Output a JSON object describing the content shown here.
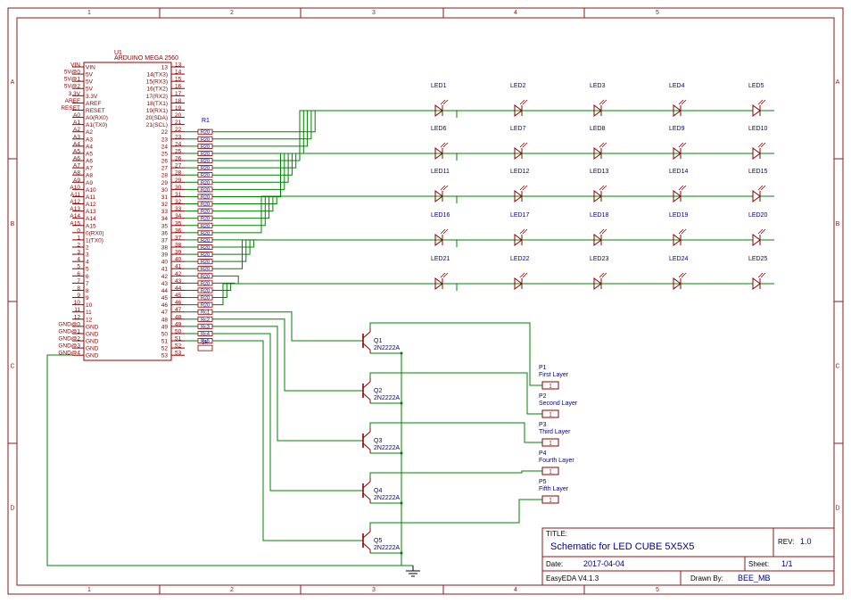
{
  "frame": {
    "col_labels": [
      "1",
      "2",
      "3",
      "4",
      "5"
    ],
    "row_labels": [
      "A",
      "B",
      "C",
      "D"
    ]
  },
  "arduino": {
    "ref": "U1",
    "name": "ARDUINO MEGA 2560",
    "left_pins": [
      {
        "num": "VIN",
        "name": "VIN"
      },
      {
        "num": "5V@0",
        "name": "5V"
      },
      {
        "num": "5V@1",
        "name": "5V"
      },
      {
        "num": "5V@2",
        "name": "5V"
      },
      {
        "num": "3.3V",
        "name": "3.3V"
      },
      {
        "num": "AREF",
        "name": "AREF"
      },
      {
        "num": "RESET",
        "name": "RESET"
      },
      {
        "num": "A0",
        "name": "A0(RX0)"
      },
      {
        "num": "A1",
        "name": "A1(TX0)"
      },
      {
        "num": "A2",
        "name": "A2"
      },
      {
        "num": "A3",
        "name": "A3"
      },
      {
        "num": "A4",
        "name": "A4"
      },
      {
        "num": "A5",
        "name": "A5"
      },
      {
        "num": "A6",
        "name": "A6"
      },
      {
        "num": "A7",
        "name": "A7"
      },
      {
        "num": "A8",
        "name": "A8"
      },
      {
        "num": "A9",
        "name": "A9"
      },
      {
        "num": "A10",
        "name": "A10"
      },
      {
        "num": "A11",
        "name": "A11"
      },
      {
        "num": "A12",
        "name": "A12"
      },
      {
        "num": "A13",
        "name": "A13"
      },
      {
        "num": "A14",
        "name": "A14"
      },
      {
        "num": "A15",
        "name": "A15"
      },
      {
        "num": "0",
        "name": "0(RX0)"
      },
      {
        "num": "1",
        "name": "1(TX0)"
      },
      {
        "num": "2",
        "name": "2"
      },
      {
        "num": "3",
        "name": "3"
      },
      {
        "num": "4",
        "name": "4"
      },
      {
        "num": "5",
        "name": "5"
      },
      {
        "num": "6",
        "name": "6"
      },
      {
        "num": "7",
        "name": "7"
      },
      {
        "num": "8",
        "name": "8"
      },
      {
        "num": "9",
        "name": "9"
      },
      {
        "num": "10",
        "name": "10"
      },
      {
        "num": "11",
        "name": "11"
      },
      {
        "num": "12",
        "name": "12"
      },
      {
        "num": "GND@0",
        "name": "GND"
      },
      {
        "num": "GND@1",
        "name": "GND"
      },
      {
        "num": "GND@2",
        "name": "GND"
      },
      {
        "num": "GND@3",
        "name": "GND"
      },
      {
        "num": "GND@4",
        "name": "GND"
      }
    ],
    "right_pins": [
      {
        "num": "13",
        "name": "13"
      },
      {
        "num": "14",
        "name": "14(TX3)"
      },
      {
        "num": "15",
        "name": "15(RX3)"
      },
      {
        "num": "16",
        "name": "16(TX2)"
      },
      {
        "num": "17",
        "name": "17(RX2)"
      },
      {
        "num": "18",
        "name": "18(TX1)"
      },
      {
        "num": "19",
        "name": "19(RX1)"
      },
      {
        "num": "20",
        "name": "20(SDA)"
      },
      {
        "num": "21",
        "name": "21(SCL)"
      },
      {
        "num": "22",
        "name": "22"
      },
      {
        "num": "23",
        "name": "23"
      },
      {
        "num": "24",
        "name": "24"
      },
      {
        "num": "25",
        "name": "25"
      },
      {
        "num": "26",
        "name": "26"
      },
      {
        "num": "27",
        "name": "27"
      },
      {
        "num": "28",
        "name": "28"
      },
      {
        "num": "29",
        "name": "29"
      },
      {
        "num": "30",
        "name": "30"
      },
      {
        "num": "31",
        "name": "31"
      },
      {
        "num": "32",
        "name": "32"
      },
      {
        "num": "33",
        "name": "33"
      },
      {
        "num": "34",
        "name": "34"
      },
      {
        "num": "35",
        "name": "35"
      },
      {
        "num": "36",
        "name": "36"
      },
      {
        "num": "37",
        "name": "37"
      },
      {
        "num": "38",
        "name": "38"
      },
      {
        "num": "39",
        "name": "39"
      },
      {
        "num": "40",
        "name": "40"
      },
      {
        "num": "41",
        "name": "41"
      },
      {
        "num": "42",
        "name": "42"
      },
      {
        "num": "43",
        "name": "43"
      },
      {
        "num": "44",
        "name": "44"
      },
      {
        "num": "45",
        "name": "45"
      },
      {
        "num": "46",
        "name": "46"
      },
      {
        "num": "47",
        "name": "47"
      },
      {
        "num": "48",
        "name": "48"
      },
      {
        "num": "49",
        "name": "49"
      },
      {
        "num": "50",
        "name": "50"
      },
      {
        "num": "51",
        "name": "51"
      },
      {
        "num": "52",
        "name": "52"
      },
      {
        "num": "53",
        "name": "53"
      }
    ]
  },
  "resistors": {
    "ref": "R1",
    "values": [
      "R20",
      "R20",
      "R20",
      "R20",
      "R20",
      "R20",
      "R20",
      "R20",
      "R20",
      "R20",
      "R20",
      "R20",
      "R20",
      "R20",
      "R20",
      "R20",
      "R20",
      "R20",
      "R20",
      "R20",
      "R20",
      "R20",
      "R20",
      "R20",
      "R20",
      "Rc1",
      "Rc2",
      "Rc3",
      "Rc4",
      "Rc5"
    ],
    "last_value": "1k"
  },
  "leds": [
    "LED1",
    "LED2",
    "LED3",
    "LED4",
    "LED5",
    "LED6",
    "LED7",
    "LED8",
    "LED9",
    "LED10",
    "LED11",
    "LED12",
    "LED13",
    "LED14",
    "LED15",
    "LED16",
    "LED17",
    "LED18",
    "LED19",
    "LED20",
    "LED21",
    "LED22",
    "LED23",
    "LED24",
    "LED25"
  ],
  "transistors": [
    {
      "ref": "Q1",
      "part": "2N2222A"
    },
    {
      "ref": "Q2",
      "part": "2N2222A"
    },
    {
      "ref": "Q3",
      "part": "2N2222A"
    },
    {
      "ref": "Q4",
      "part": "2N2222A"
    },
    {
      "ref": "Q5",
      "part": "2N2222A"
    }
  ],
  "connectors": [
    {
      "ref": "P1",
      "name": "First Layer",
      "pin": "1"
    },
    {
      "ref": "P2",
      "name": "Second Layer",
      "pin": "1"
    },
    {
      "ref": "P3",
      "name": "Third Layer",
      "pin": "1"
    },
    {
      "ref": "P4",
      "name": "Fourth Layer",
      "pin": "1"
    },
    {
      "ref": "P5",
      "name": "Fifth Layer",
      "pin": "1"
    }
  ],
  "title_block": {
    "title_label": "TITLE:",
    "title": "Schematic for LED CUBE 5X5X5",
    "rev_label": "REV:",
    "rev": "1.0",
    "date_label": "Date:",
    "date": "2017-04-04",
    "sheet_label": "Sheet:",
    "sheet": "1/1",
    "software": "EasyEDA V4.1.3",
    "drawn_by_label": "Drawn By:",
    "drawn_by": "BEE_MB"
  },
  "colors": {
    "frame": "#8b1a1a",
    "component": "#8b0000",
    "wire": "#008000",
    "label": "#00008b"
  }
}
